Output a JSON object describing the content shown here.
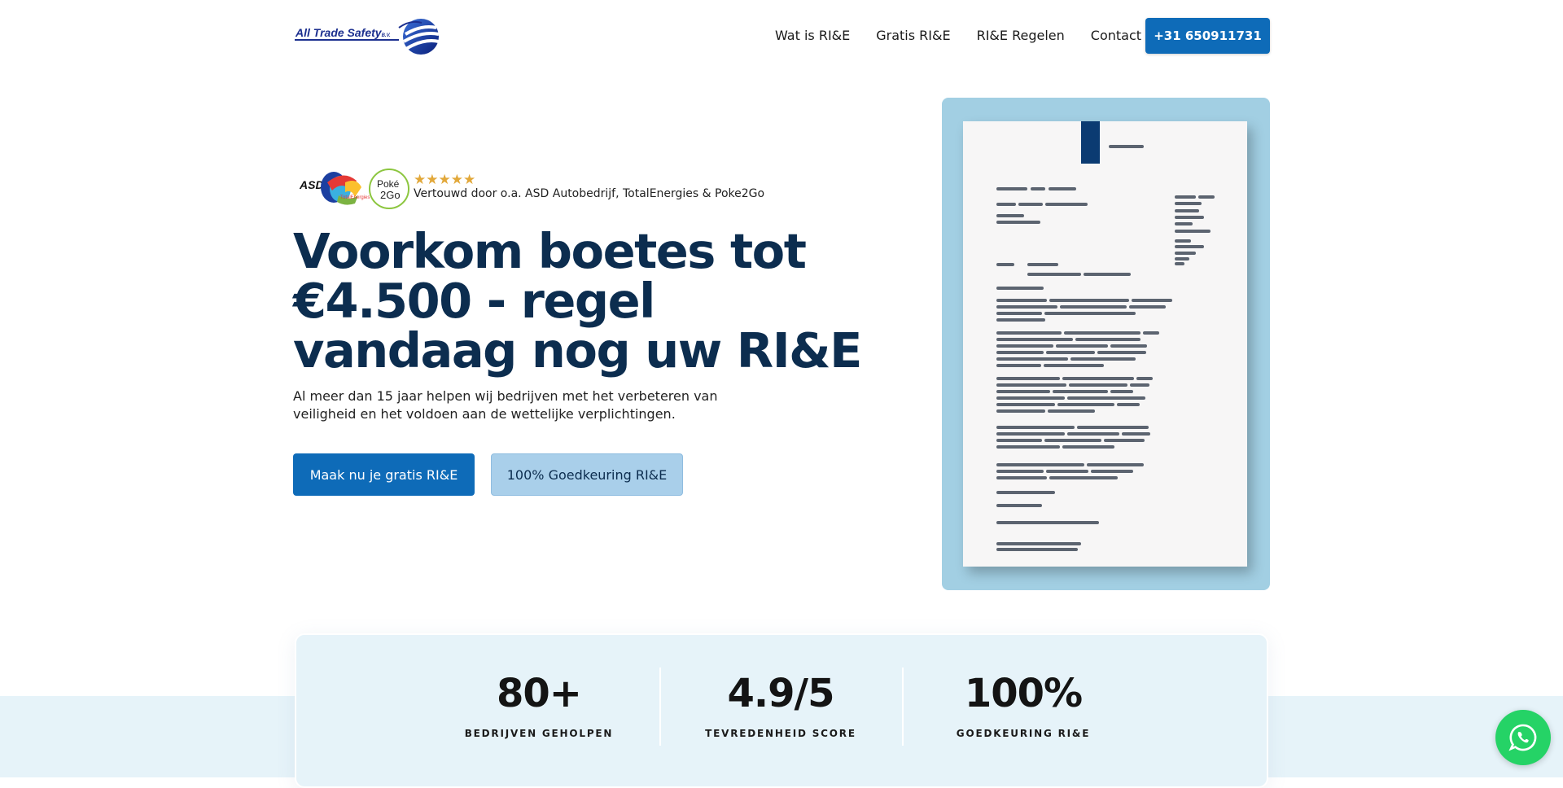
{
  "brand": {
    "logo_text": "All Trade Safety",
    "logo_suffix": "B.V.",
    "primary_color": "#0e6bb8",
    "heading_color": "#0c2d4f",
    "accent_light": "#a9cfea",
    "star_color": "#e2a83a",
    "whatsapp_color": "#25d366"
  },
  "nav": {
    "items": [
      {
        "label": "Wat is RI&E"
      },
      {
        "label": "Gratis RI&E"
      },
      {
        "label": "RI&E Regelen"
      },
      {
        "label": "Contact"
      }
    ],
    "phone_button": "+31 650911731"
  },
  "hero": {
    "trust": {
      "stars": "★★★★★",
      "rating_stars": 5,
      "text": "Vertouwd door o.a. ASD Autobedrijf, TotalEnergies & Poke2Go",
      "logos": [
        "ASD",
        "TotalEnergies",
        "Poké 2Go"
      ]
    },
    "headline": "Voorkom boetes tot €4.500 - regel vandaag nog uw RI&E",
    "subtext": "Al meer dan 15 jaar helpen wij bedrijven met het verbeteren van veiligheid en het voldoen aan de wettelijke verplichtingen.",
    "cta_primary": "Maak nu je gratis RI&E",
    "cta_secondary": "100% Goedkeuring RI&E"
  },
  "stats": [
    {
      "value": "80+",
      "label": "BEDRIJVEN GEHOLPEN"
    },
    {
      "value": "4.9/5",
      "label": "TEVREDENHEID SCORE"
    },
    {
      "value": "100%",
      "label": "GOEDKEURING RI&E"
    }
  ],
  "icons": {
    "whatsapp": "whatsapp-icon",
    "document": "document-illustration",
    "star": "star-icon"
  }
}
